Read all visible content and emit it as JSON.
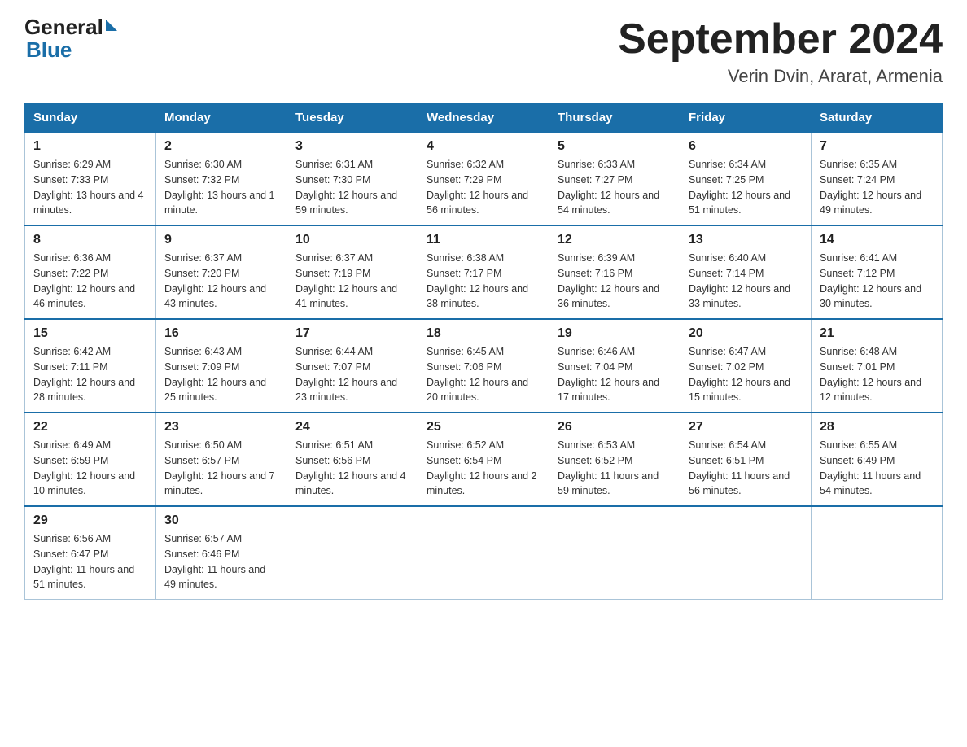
{
  "logo": {
    "general": "General",
    "blue": "Blue"
  },
  "title": "September 2024",
  "subtitle": "Verin Dvin, Ararat, Armenia",
  "weekdays": [
    "Sunday",
    "Monday",
    "Tuesday",
    "Wednesday",
    "Thursday",
    "Friday",
    "Saturday"
  ],
  "weeks": [
    [
      {
        "day": "1",
        "sunrise": "6:29 AM",
        "sunset": "7:33 PM",
        "daylight": "13 hours and 4 minutes."
      },
      {
        "day": "2",
        "sunrise": "6:30 AM",
        "sunset": "7:32 PM",
        "daylight": "13 hours and 1 minute."
      },
      {
        "day": "3",
        "sunrise": "6:31 AM",
        "sunset": "7:30 PM",
        "daylight": "12 hours and 59 minutes."
      },
      {
        "day": "4",
        "sunrise": "6:32 AM",
        "sunset": "7:29 PM",
        "daylight": "12 hours and 56 minutes."
      },
      {
        "day": "5",
        "sunrise": "6:33 AM",
        "sunset": "7:27 PM",
        "daylight": "12 hours and 54 minutes."
      },
      {
        "day": "6",
        "sunrise": "6:34 AM",
        "sunset": "7:25 PM",
        "daylight": "12 hours and 51 minutes."
      },
      {
        "day": "7",
        "sunrise": "6:35 AM",
        "sunset": "7:24 PM",
        "daylight": "12 hours and 49 minutes."
      }
    ],
    [
      {
        "day": "8",
        "sunrise": "6:36 AM",
        "sunset": "7:22 PM",
        "daylight": "12 hours and 46 minutes."
      },
      {
        "day": "9",
        "sunrise": "6:37 AM",
        "sunset": "7:20 PM",
        "daylight": "12 hours and 43 minutes."
      },
      {
        "day": "10",
        "sunrise": "6:37 AM",
        "sunset": "7:19 PM",
        "daylight": "12 hours and 41 minutes."
      },
      {
        "day": "11",
        "sunrise": "6:38 AM",
        "sunset": "7:17 PM",
        "daylight": "12 hours and 38 minutes."
      },
      {
        "day": "12",
        "sunrise": "6:39 AM",
        "sunset": "7:16 PM",
        "daylight": "12 hours and 36 minutes."
      },
      {
        "day": "13",
        "sunrise": "6:40 AM",
        "sunset": "7:14 PM",
        "daylight": "12 hours and 33 minutes."
      },
      {
        "day": "14",
        "sunrise": "6:41 AM",
        "sunset": "7:12 PM",
        "daylight": "12 hours and 30 minutes."
      }
    ],
    [
      {
        "day": "15",
        "sunrise": "6:42 AM",
        "sunset": "7:11 PM",
        "daylight": "12 hours and 28 minutes."
      },
      {
        "day": "16",
        "sunrise": "6:43 AM",
        "sunset": "7:09 PM",
        "daylight": "12 hours and 25 minutes."
      },
      {
        "day": "17",
        "sunrise": "6:44 AM",
        "sunset": "7:07 PM",
        "daylight": "12 hours and 23 minutes."
      },
      {
        "day": "18",
        "sunrise": "6:45 AM",
        "sunset": "7:06 PM",
        "daylight": "12 hours and 20 minutes."
      },
      {
        "day": "19",
        "sunrise": "6:46 AM",
        "sunset": "7:04 PM",
        "daylight": "12 hours and 17 minutes."
      },
      {
        "day": "20",
        "sunrise": "6:47 AM",
        "sunset": "7:02 PM",
        "daylight": "12 hours and 15 minutes."
      },
      {
        "day": "21",
        "sunrise": "6:48 AM",
        "sunset": "7:01 PM",
        "daylight": "12 hours and 12 minutes."
      }
    ],
    [
      {
        "day": "22",
        "sunrise": "6:49 AM",
        "sunset": "6:59 PM",
        "daylight": "12 hours and 10 minutes."
      },
      {
        "day": "23",
        "sunrise": "6:50 AM",
        "sunset": "6:57 PM",
        "daylight": "12 hours and 7 minutes."
      },
      {
        "day": "24",
        "sunrise": "6:51 AM",
        "sunset": "6:56 PM",
        "daylight": "12 hours and 4 minutes."
      },
      {
        "day": "25",
        "sunrise": "6:52 AM",
        "sunset": "6:54 PM",
        "daylight": "12 hours and 2 minutes."
      },
      {
        "day": "26",
        "sunrise": "6:53 AM",
        "sunset": "6:52 PM",
        "daylight": "11 hours and 59 minutes."
      },
      {
        "day": "27",
        "sunrise": "6:54 AM",
        "sunset": "6:51 PM",
        "daylight": "11 hours and 56 minutes."
      },
      {
        "day": "28",
        "sunrise": "6:55 AM",
        "sunset": "6:49 PM",
        "daylight": "11 hours and 54 minutes."
      }
    ],
    [
      {
        "day": "29",
        "sunrise": "6:56 AM",
        "sunset": "6:47 PM",
        "daylight": "11 hours and 51 minutes."
      },
      {
        "day": "30",
        "sunrise": "6:57 AM",
        "sunset": "6:46 PM",
        "daylight": "11 hours and 49 minutes."
      },
      null,
      null,
      null,
      null,
      null
    ]
  ]
}
